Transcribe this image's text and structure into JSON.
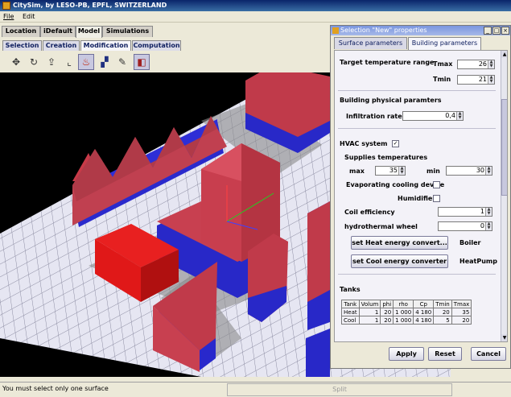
{
  "app": {
    "title": "CitySim, by LESO-PB, EPFL, SWITZERLAND"
  },
  "menu": {
    "file": "File",
    "edit": "Edit"
  },
  "main_tabs": [
    {
      "label": "Location"
    },
    {
      "label": "iDefault"
    },
    {
      "label": "Model"
    },
    {
      "label": "Simulations"
    }
  ],
  "sub_tabs": [
    {
      "label": "Selection"
    },
    {
      "label": "Creation"
    },
    {
      "label": "Modification"
    },
    {
      "label": "Computation"
    }
  ],
  "toolbar_icons": [
    "move-icon",
    "rotate-icon",
    "extrude-icon",
    "corner-icon",
    "fire-icon",
    "paint-icon",
    "pipette-icon",
    "cylinder-icon"
  ],
  "status": {
    "message": "You must select only one surface",
    "split": "Split"
  },
  "dialog": {
    "title": "Selection \"New\" properties",
    "tabs": [
      "Surface parameters",
      "Building parameters"
    ],
    "target_temp": {
      "label": "Target temperature range",
      "tmax_label": "Tmax",
      "tmax": "26",
      "tmin_label": "Tmin",
      "tmin": "21"
    },
    "physical": {
      "label": "Building physical paramters",
      "infiltration_label": "Infiltration rate :",
      "infiltration": "0,4"
    },
    "hvac": {
      "label": "HVAC system",
      "checked": "✓",
      "supplies_label": "Supplies temperatures",
      "max_label": "max",
      "max": "35",
      "min_label": "min",
      "min": "30",
      "evap_label": "Evaporating cooling device",
      "humid_label": "Humidifier",
      "coil_label": "Coil efficiency",
      "coil": "1",
      "wheel_label": "hydrothermal wheel",
      "wheel": "0",
      "heat_button": "set Heat energy convert...",
      "heat_value": "Boiler",
      "cool_button": "set Cool energy converter",
      "cool_value": "HeatPump"
    },
    "tanks": {
      "label": "Tanks",
      "headers": [
        "Tank",
        "Volum",
        "phi",
        "rho",
        "Cp",
        "Tmin",
        "Tmax"
      ],
      "rows": [
        [
          "Heat",
          "1",
          "20",
          "1 000",
          "4 180",
          "20",
          "35"
        ],
        [
          "Cool",
          "1",
          "20",
          "1 000",
          "4 180",
          "5",
          "20"
        ]
      ]
    },
    "buttons": {
      "apply": "Apply",
      "reset": "Reset",
      "cancel": "Cancel"
    }
  }
}
